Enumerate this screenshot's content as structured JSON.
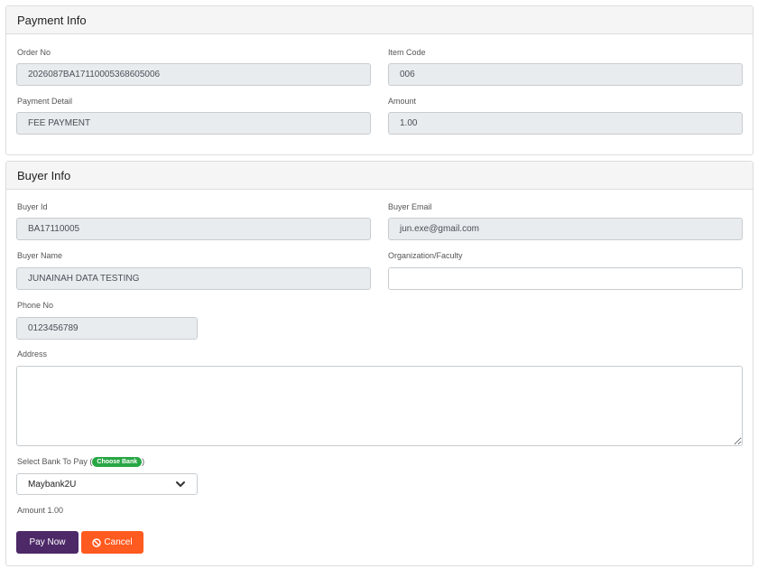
{
  "payment_info": {
    "title": "Payment Info",
    "order_no": {
      "label": "Order No",
      "value": "2026087BA17110005368605006"
    },
    "item_code": {
      "label": "Item Code",
      "value": "006"
    },
    "payment_detail": {
      "label": "Payment Detail",
      "value": "FEE PAYMENT"
    },
    "amount": {
      "label": "Amount",
      "value": "1.00"
    }
  },
  "buyer_info": {
    "title": "Buyer Info",
    "buyer_id": {
      "label": "Buyer Id",
      "value": "BA17110005"
    },
    "buyer_email": {
      "label": "Buyer Email",
      "value": "jun.exe@gmail.com"
    },
    "buyer_name": {
      "label": "Buyer Name",
      "value": "JUNAINAH DATA TESTING"
    },
    "organization": {
      "label": "Organization/Faculty",
      "value": ""
    },
    "phone_no": {
      "label": "Phone No",
      "value": "0123456789"
    },
    "address": {
      "label": "Address",
      "value": ""
    },
    "bank": {
      "label_prefix": "Select Bank To Pay (",
      "badge": "Choose Bank",
      "label_suffix": ")",
      "selected": "Maybank2U"
    },
    "amount_text": "Amount 1.00",
    "pay_button": "Pay Now",
    "cancel_button": "Cancel"
  },
  "colors": {
    "primary": "#4d2968",
    "cancel": "#ff5a1f",
    "badge": "#28a745",
    "readonly_bg": "#e9ecef"
  },
  "icons": {
    "select_arrow": "chevron-down-icon",
    "cancel": "ban-icon"
  }
}
